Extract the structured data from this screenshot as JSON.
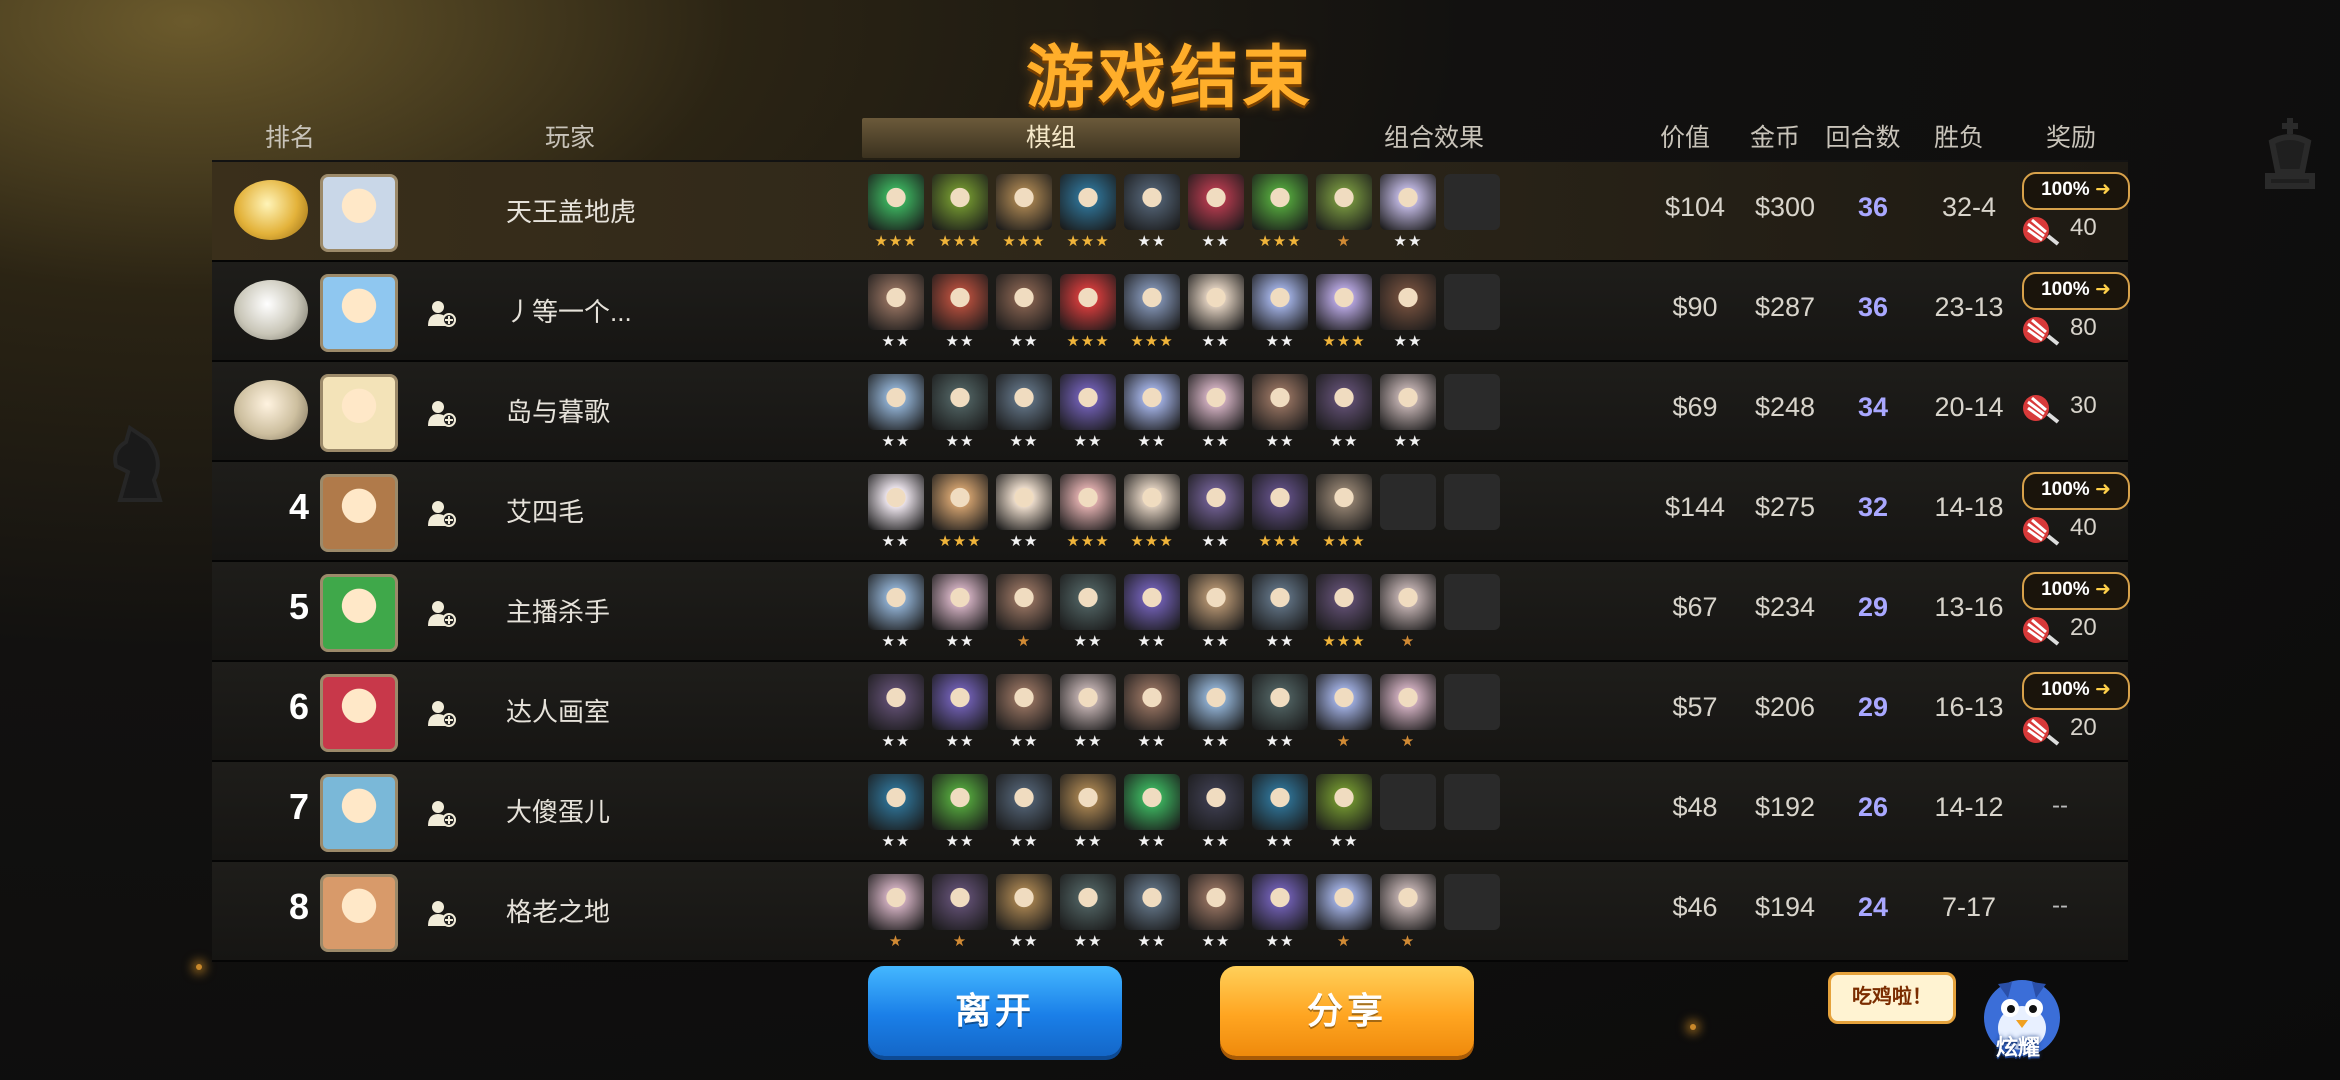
{
  "title": "游戏结束",
  "columns": {
    "rank": "排名",
    "player": "玩家",
    "lineup": "棋组",
    "synergy": "组合效果",
    "value": "价值",
    "gold": "金币",
    "rounds": "回合数",
    "record": "胜负",
    "reward": "奖励"
  },
  "players": [
    {
      "rank": "1",
      "name": "天王盖地虎",
      "value": "$104",
      "gold": "$300",
      "rounds": "36",
      "record": "32-4",
      "badge": "100%",
      "reward": "40",
      "units": [
        [
          "#3aa85a",
          "★★★"
        ],
        [
          "#6a8a2e",
          "★★★"
        ],
        [
          "#9b7a4c",
          "★★★"
        ],
        [
          "#2d6a8a",
          "★★★"
        ],
        [
          "#4c5a6a",
          "★★"
        ],
        [
          "#a8384a",
          "★★"
        ],
        [
          "#4f9a3a",
          "★★★"
        ],
        [
          "#6e8a3c",
          "★"
        ],
        [
          "#b8b0d8",
          "★★"
        ],
        [
          "",
          ""
        ]
      ]
    },
    {
      "rank": "2",
      "name": "丿等一个...",
      "value": "$90",
      "gold": "$287",
      "rounds": "36",
      "record": "23-13",
      "badge": "100%",
      "reward": "80",
      "units": [
        [
          "#8a6a5a",
          "★★"
        ],
        [
          "#a84a3a",
          "★★"
        ],
        [
          "#7a5a4a",
          "★★"
        ],
        [
          "#c83a3a",
          "★★★"
        ],
        [
          "#7a8aa8",
          "★★★"
        ],
        [
          "#d8c8b8",
          "★★"
        ],
        [
          "#9aa8d8",
          "★★"
        ],
        [
          "#b0a0d8",
          "★★★"
        ],
        [
          "#6a4a3a",
          "★★"
        ],
        [
          "",
          ""
        ]
      ]
    },
    {
      "rank": "3",
      "name": "岛与暮歌",
      "value": "$69",
      "gold": "$248",
      "rounds": "34",
      "record": "20-14",
      "badge": "",
      "reward": "30",
      "units": [
        [
          "#8aa8c8",
          "★★"
        ],
        [
          "#4a5a5a",
          "★★"
        ],
        [
          "#5a6a7a",
          "★★"
        ],
        [
          "#6a5aa8",
          "★★"
        ],
        [
          "#9aa8d8",
          "★★"
        ],
        [
          "#c8a8b8",
          "★★"
        ],
        [
          "#8a6a5a",
          "★★"
        ],
        [
          "#5a4a6a",
          "★★"
        ],
        [
          "#b8a8a8",
          "★★"
        ],
        [
          "",
          ""
        ]
      ]
    },
    {
      "rank": "4",
      "name": "艾四毛",
      "value": "$144",
      "gold": "$275",
      "rounds": "32",
      "record": "14-18",
      "badge": "100%",
      "reward": "40",
      "units": [
        [
          "#e8e0e8",
          "★★"
        ],
        [
          "#c89a6a",
          "★★★"
        ],
        [
          "#e8d8c8",
          "★★"
        ],
        [
          "#d8a8a8",
          "★★★"
        ],
        [
          "#d8c8b8",
          "★★★"
        ],
        [
          "#6a5a8a",
          "★★"
        ],
        [
          "#5a4a7a",
          "★★★"
        ],
        [
          "#8a7a6a",
          "★★★"
        ],
        [
          "",
          ""
        ],
        [
          "",
          ""
        ]
      ]
    },
    {
      "rank": "5",
      "name": "主播杀手",
      "value": "$67",
      "gold": "$234",
      "rounds": "29",
      "record": "13-16",
      "badge": "100%",
      "reward": "20",
      "units": [
        [
          "#8aa8c8",
          "★★"
        ],
        [
          "#c8a8b8",
          "★★"
        ],
        [
          "#8a6a5a",
          "★"
        ],
        [
          "#4a5a5a",
          "★★"
        ],
        [
          "#6a5aa8",
          "★★"
        ],
        [
          "#a88a6a",
          "★★"
        ],
        [
          "#5a6a7a",
          "★★"
        ],
        [
          "#5a4a6a",
          "★★★"
        ],
        [
          "#b8a8a8",
          "★"
        ],
        [
          "",
          ""
        ]
      ]
    },
    {
      "rank": "6",
      "name": "达人画室",
      "value": "$57",
      "gold": "$206",
      "rounds": "29",
      "record": "16-13",
      "badge": "100%",
      "reward": "20",
      "units": [
        [
          "#5a4a6a",
          "★★"
        ],
        [
          "#6a5aa8",
          "★★"
        ],
        [
          "#8a6a5a",
          "★★"
        ],
        [
          "#b8a8a8",
          "★★"
        ],
        [
          "#8a6a5a",
          "★★"
        ],
        [
          "#8aa8c8",
          "★★"
        ],
        [
          "#4a5a5a",
          "★★"
        ],
        [
          "#9aa8d8",
          "★"
        ],
        [
          "#c8a8b8",
          "★"
        ],
        [
          "",
          ""
        ]
      ]
    },
    {
      "rank": "7",
      "name": "大傻蛋儿",
      "value": "$48",
      "gold": "$192",
      "rounds": "26",
      "record": "14-12",
      "badge": "",
      "reward": "--",
      "units": [
        [
          "#2d6a8a",
          "★★"
        ],
        [
          "#4f9a3a",
          "★★"
        ],
        [
          "#4c5a6a",
          "★★"
        ],
        [
          "#9b7a4c",
          "★★"
        ],
        [
          "#3aa85a",
          "★★"
        ],
        [
          "#3a3a4a",
          "★★"
        ],
        [
          "#2d6a8a",
          "★★"
        ],
        [
          "#6a8a2e",
          "★★"
        ],
        [
          "",
          ""
        ],
        [
          "",
          ""
        ]
      ]
    },
    {
      "rank": "8",
      "name": "格老之地",
      "value": "$46",
      "gold": "$194",
      "rounds": "24",
      "record": "7-17",
      "badge": "",
      "reward": "--",
      "units": [
        [
          "#c8a8b8",
          "★"
        ],
        [
          "#5a4a6a",
          "★"
        ],
        [
          "#9b7a4c",
          "★★"
        ],
        [
          "#4a5a5a",
          "★★"
        ],
        [
          "#5a6a7a",
          "★★"
        ],
        [
          "#8a6a5a",
          "★★"
        ],
        [
          "#6a5aa8",
          "★★"
        ],
        [
          "#9aa8d8",
          "★"
        ],
        [
          "#b8a8a8",
          "★"
        ],
        [
          "",
          ""
        ]
      ]
    }
  ],
  "buttons": {
    "leave": "离开",
    "share": "分享"
  },
  "bubble": "吃鸡啦！",
  "mascot_label": "炫耀",
  "colors": {
    "title": "#ffae2a",
    "rounds": "#a9a8ff",
    "leave": "#1a7fe8",
    "share": "#ffa521"
  }
}
